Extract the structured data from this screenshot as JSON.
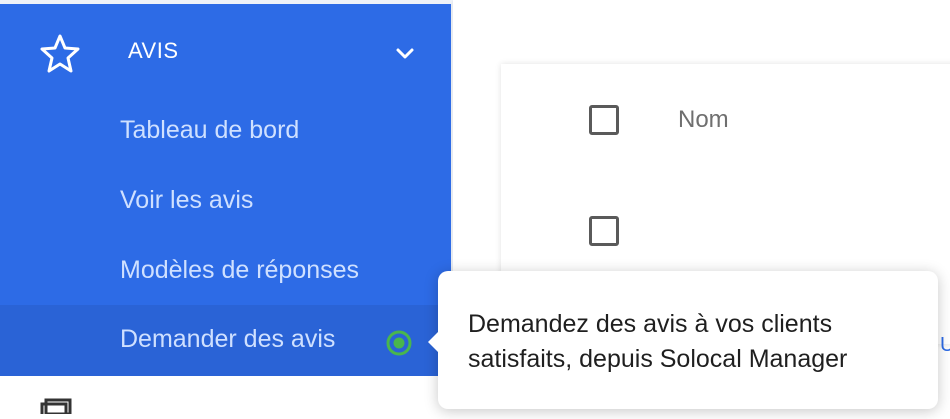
{
  "sidebar": {
    "section": {
      "title": "AVIS",
      "icon": "star-icon",
      "expand_icon": "chevron-down-icon"
    },
    "items": [
      {
        "label": "Tableau de bord"
      },
      {
        "label": "Voir les avis"
      },
      {
        "label": "Modèles de réponses"
      },
      {
        "label": "Demander des avis",
        "active": true,
        "status_icon": "green-dot-icon"
      }
    ]
  },
  "table": {
    "header": {
      "col_name": "Nom"
    },
    "edge_text": "U"
  },
  "tooltip": {
    "text": "Demandez des avis à vos clients satisfaits, depuis Solocal Manager"
  },
  "colors": {
    "sidebar_bg": "#2d6be6",
    "sidebar_active_bg": "#2a63d6",
    "sidebar_text": "#cfe0ff",
    "status_green": "#49b64d"
  }
}
